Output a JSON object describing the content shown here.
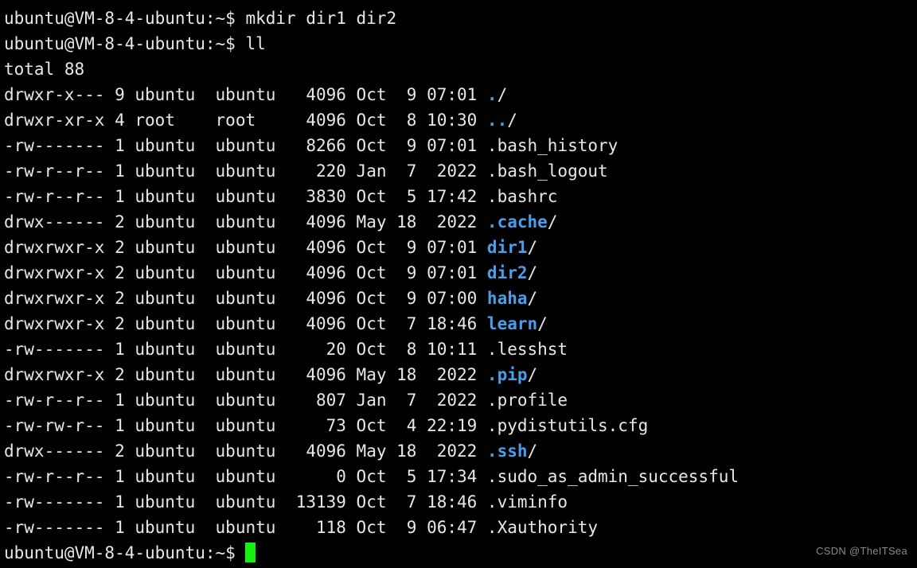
{
  "terminal": {
    "prompt": "ubuntu@VM-8-4-ubuntu:~$ ",
    "colors": {
      "background": "#000000",
      "foreground": "#e8e8e8",
      "directory": "#4a9eea",
      "cursor": "#15f015",
      "watermark": "#8a8a8a"
    },
    "commands": [
      {
        "prompt": "ubuntu@VM-8-4-ubuntu:~$ ",
        "command": "mkdir dir1 dir2"
      },
      {
        "prompt": "ubuntu@VM-8-4-ubuntu:~$ ",
        "command": "ll"
      }
    ],
    "total_line": "total 88",
    "listing": [
      {
        "perms": "drwxr-x---",
        "links": "9",
        "owner": "ubuntu",
        "group": "ubuntu",
        "size": "4096",
        "month": "Oct",
        "day": "9",
        "time": "07:01",
        "name": ".",
        "suffix": "/",
        "type": "dir"
      },
      {
        "perms": "drwxr-xr-x",
        "links": "4",
        "owner": "root",
        "group": "root",
        "size": "4096",
        "month": "Oct",
        "day": "8",
        "time": "10:30",
        "name": "..",
        "suffix": "/",
        "type": "dir"
      },
      {
        "perms": "-rw-------",
        "links": "1",
        "owner": "ubuntu",
        "group": "ubuntu",
        "size": "8266",
        "month": "Oct",
        "day": "9",
        "time": "07:01",
        "name": ".bash_history",
        "suffix": "",
        "type": "file"
      },
      {
        "perms": "-rw-r--r--",
        "links": "1",
        "owner": "ubuntu",
        "group": "ubuntu",
        "size": "220",
        "month": "Jan",
        "day": "7",
        "time": "2022",
        "name": ".bash_logout",
        "suffix": "",
        "type": "file"
      },
      {
        "perms": "-rw-r--r--",
        "links": "1",
        "owner": "ubuntu",
        "group": "ubuntu",
        "size": "3830",
        "month": "Oct",
        "day": "5",
        "time": "17:42",
        "name": ".bashrc",
        "suffix": "",
        "type": "file"
      },
      {
        "perms": "drwx------",
        "links": "2",
        "owner": "ubuntu",
        "group": "ubuntu",
        "size": "4096",
        "month": "May",
        "day": "18",
        "time": "2022",
        "name": ".cache",
        "suffix": "/",
        "type": "dir"
      },
      {
        "perms": "drwxrwxr-x",
        "links": "2",
        "owner": "ubuntu",
        "group": "ubuntu",
        "size": "4096",
        "month": "Oct",
        "day": "9",
        "time": "07:01",
        "name": "dir1",
        "suffix": "/",
        "type": "dir"
      },
      {
        "perms": "drwxrwxr-x",
        "links": "2",
        "owner": "ubuntu",
        "group": "ubuntu",
        "size": "4096",
        "month": "Oct",
        "day": "9",
        "time": "07:01",
        "name": "dir2",
        "suffix": "/",
        "type": "dir"
      },
      {
        "perms": "drwxrwxr-x",
        "links": "2",
        "owner": "ubuntu",
        "group": "ubuntu",
        "size": "4096",
        "month": "Oct",
        "day": "9",
        "time": "07:00",
        "name": "haha",
        "suffix": "/",
        "type": "dir"
      },
      {
        "perms": "drwxrwxr-x",
        "links": "2",
        "owner": "ubuntu",
        "group": "ubuntu",
        "size": "4096",
        "month": "Oct",
        "day": "7",
        "time": "18:46",
        "name": "learn",
        "suffix": "/",
        "type": "dir"
      },
      {
        "perms": "-rw-------",
        "links": "1",
        "owner": "ubuntu",
        "group": "ubuntu",
        "size": "20",
        "month": "Oct",
        "day": "8",
        "time": "10:11",
        "name": ".lesshst",
        "suffix": "",
        "type": "file"
      },
      {
        "perms": "drwxrwxr-x",
        "links": "2",
        "owner": "ubuntu",
        "group": "ubuntu",
        "size": "4096",
        "month": "May",
        "day": "18",
        "time": "2022",
        "name": ".pip",
        "suffix": "/",
        "type": "dir"
      },
      {
        "perms": "-rw-r--r--",
        "links": "1",
        "owner": "ubuntu",
        "group": "ubuntu",
        "size": "807",
        "month": "Jan",
        "day": "7",
        "time": "2022",
        "name": ".profile",
        "suffix": "",
        "type": "file"
      },
      {
        "perms": "-rw-rw-r--",
        "links": "1",
        "owner": "ubuntu",
        "group": "ubuntu",
        "size": "73",
        "month": "Oct",
        "day": "4",
        "time": "22:19",
        "name": ".pydistutils.cfg",
        "suffix": "",
        "type": "file"
      },
      {
        "perms": "drwx------",
        "links": "2",
        "owner": "ubuntu",
        "group": "ubuntu",
        "size": "4096",
        "month": "May",
        "day": "18",
        "time": "2022",
        "name": ".ssh",
        "suffix": "/",
        "type": "dir"
      },
      {
        "perms": "-rw-r--r--",
        "links": "1",
        "owner": "ubuntu",
        "group": "ubuntu",
        "size": "0",
        "month": "Oct",
        "day": "5",
        "time": "17:34",
        "name": ".sudo_as_admin_successful",
        "suffix": "",
        "type": "file"
      },
      {
        "perms": "-rw-------",
        "links": "1",
        "owner": "ubuntu",
        "group": "ubuntu",
        "size": "13139",
        "month": "Oct",
        "day": "7",
        "time": "18:46",
        "name": ".viminfo",
        "suffix": "",
        "type": "file"
      },
      {
        "perms": "-rw-------",
        "links": "1",
        "owner": "ubuntu",
        "group": "ubuntu",
        "size": "118",
        "month": "Oct",
        "day": "9",
        "time": "06:47",
        "name": ".Xauthority",
        "suffix": "",
        "type": "file"
      }
    ],
    "final_prompt": "ubuntu@VM-8-4-ubuntu:~$ ",
    "watermark": "CSDN @TheITSea"
  }
}
